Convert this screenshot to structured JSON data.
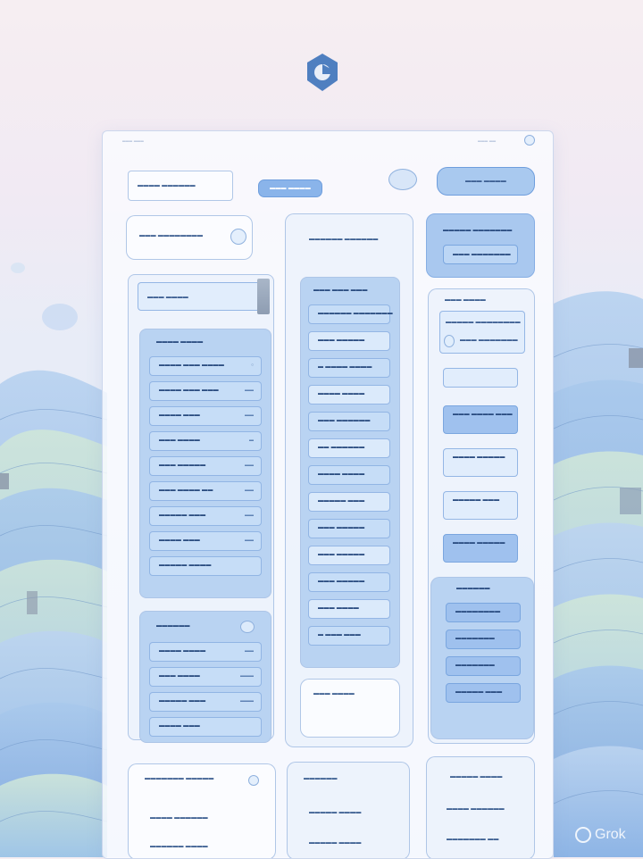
{
  "app": {
    "watermark": "Grok"
  },
  "header": {
    "left_text": "═══  ═══",
    "right_text": "═══ ══",
    "logo_name": "app-logo"
  },
  "top_row": {
    "search_placeholder": "▬▬▬▬ ▬▬▬▬▬▬",
    "primary_button": "▬▬▬ ▬▬▬▬",
    "right_pill": "▬▬▬ ▬▬▬▬"
  },
  "left_panel": {
    "title": "▬▬▬ ▬▬▬▬▬▬▬▬",
    "sub_header": "▬▬▬ ▬▬▬▬",
    "list_header": "▬▬▬▬ ▬▬▬▬",
    "list_items": [
      {
        "label": "▬▬▬▬ ▬▬▬ ▬▬▬▬",
        "meta": "○"
      },
      {
        "label": "▬▬▬▬ ▬▬▬ ▬▬▬",
        "meta": "▬▬"
      },
      {
        "label": "▬▬▬▬ ▬▬▬",
        "meta": "▬▬"
      },
      {
        "label": "▬▬▬ ▬▬▬▬",
        "meta": "▬"
      },
      {
        "label": "▬▬▬ ▬▬▬▬▬",
        "meta": "▬▬"
      },
      {
        "label": "▬▬▬ ▬▬▬▬ ▬▬",
        "meta": "▬▬"
      },
      {
        "label": "▬▬▬▬▬ ▬▬▬",
        "meta": "▬▬"
      },
      {
        "label": "▬▬▬▬ ▬▬▬",
        "meta": "▬▬"
      },
      {
        "label": "▬▬▬▬▬ ▬▬▬▬",
        "meta": ""
      }
    ],
    "lower_title": "▬▬▬▬▬▬",
    "lower_items": [
      {
        "label": "▬▬▬▬ ▬▬▬▬",
        "meta": "▬▬"
      },
      {
        "label": "▬▬▬ ▬▬▬▬",
        "meta": "▬▬▬"
      },
      {
        "label": "▬▬▬▬▬ ▬▬▬",
        "meta": "▬▬▬"
      },
      {
        "label": "▬▬▬▬ ▬▬▬",
        "meta": ""
      }
    ]
  },
  "middle_panel": {
    "title": "▬▬▬▬▬▬ ▬▬▬▬▬▬",
    "list_header": "▬▬▬ ▬▬▬ ▬▬▬",
    "items": [
      "▬▬▬▬▬▬ ▬▬▬▬▬▬▬",
      "▬▬▬ ▬▬▬▬▬",
      "▬ ▬▬▬▬ ▬▬▬▬",
      "▬▬▬▬ ▬▬▬▬",
      "▬▬▬ ▬▬▬▬▬▬",
      "▬▬ ▬▬▬▬▬▬",
      "▬▬▬▬ ▬▬▬▬",
      "▬▬▬▬▬ ▬▬▬",
      "▬▬▬ ▬▬▬▬▬",
      "▬▬▬ ▬▬▬▬▬",
      "▬▬▬ ▬▬▬▬▬",
      "▬▬▬ ▬▬▬▬",
      "▬ ▬▬▬ ▬▬▬"
    ],
    "footer_box": "▬▬▬ ▬▬▬▬"
  },
  "right_panel": {
    "top_card_title": "▬▬▬▬▬ ▬▬▬▬▬▬▬",
    "top_card_button": "▬▬▬ ▬▬▬▬▬▬▬",
    "info_title": "▬▬▬ ▬▬▬▬",
    "info_sub": "▬▬▬▬▬ ▬▬▬▬▬▬▬▬",
    "info_detail": "▬▬▬ ▬▬▬▬▬▬▬",
    "buttons": [
      "▬▬▬ ▬▬▬▬ ▬▬▬",
      "▬▬▬▬ ▬▬▬▬▬",
      "▬▬▬▬▬ ▬▬▬",
      "▬▬▬▬ ▬▬▬▬▬"
    ],
    "lower_title": "▬▬▬▬▬▬",
    "lower_items": [
      "▬▬▬▬▬▬▬▬",
      "▬▬▬▬▬▬▬",
      "▬▬▬▬▬▬▬",
      "▬▬▬▬▬ ▬▬▬"
    ]
  },
  "bottom_row": {
    "left_title": "▬▬▬▬▬▬▬ ▬▬▬▬▬",
    "left_items": [
      "▬▬▬▬ ▬▬▬▬▬▬",
      "▬▬▬▬▬▬ ▬▬▬▬"
    ],
    "mid_title": "▬▬▬▬▬▬",
    "mid_items": [
      "▬▬▬▬▬ ▬▬▬▬",
      "▬▬▬▬▬ ▬▬▬▬"
    ],
    "right_title": "▬▬▬▬▬ ▬▬▬▬",
    "right_items": [
      "▬▬▬▬ ▬▬▬▬▬▬",
      "▬▬▬▬▬▬▬ ▬▬"
    ]
  },
  "colors": {
    "accent": "#8ab4ea",
    "panel_blue": "#b9d3f2",
    "text": "#3d5f92"
  }
}
